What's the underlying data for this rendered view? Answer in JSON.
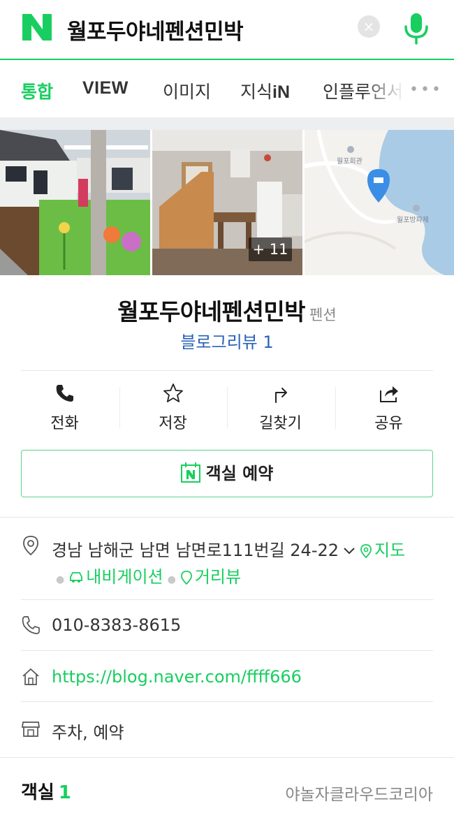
{
  "search": {
    "query": "월포두야네펜션민박",
    "clear_glyph": "×"
  },
  "tabs": [
    {
      "label": "통합",
      "active": true
    },
    {
      "label": "VIEW"
    },
    {
      "label": "이미지"
    },
    {
      "label": "지식"
    },
    {
      "label": "인플루언서"
    }
  ],
  "tab_suffix": "iN",
  "more_tabs": "•••",
  "photos": {
    "more_count": "+ 11",
    "map_labels": [
      "월포회관",
      "월포방파제"
    ]
  },
  "place": {
    "name": "월포두야네펜션민박",
    "category": "펜션",
    "blog_review": "블로그리뷰 1"
  },
  "actions": [
    {
      "label": "전화",
      "icon": "phone-icon"
    },
    {
      "label": "저장",
      "icon": "star-icon"
    },
    {
      "label": "길찾기",
      "icon": "directions-icon"
    },
    {
      "label": "공유",
      "icon": "share-icon"
    }
  ],
  "reserve_label": "객실 예약",
  "info": {
    "address": "경남 남해군 남면 남면로111번길 24-22",
    "map_link": "지도",
    "navigation_link": "내비게이션",
    "street_view_link": "거리뷰",
    "phone": "010-8383-8615",
    "homepage": "https://blog.naver.com/ffff666",
    "facilities": "주차, 예약"
  },
  "rooms": {
    "title": "객실",
    "count": "1",
    "provider": "야놀자클라우드코리아"
  },
  "colors": {
    "brand_green": "#19ce60",
    "link_blue": "#2a62b9",
    "map_pin_blue": "#3a8ee6"
  }
}
